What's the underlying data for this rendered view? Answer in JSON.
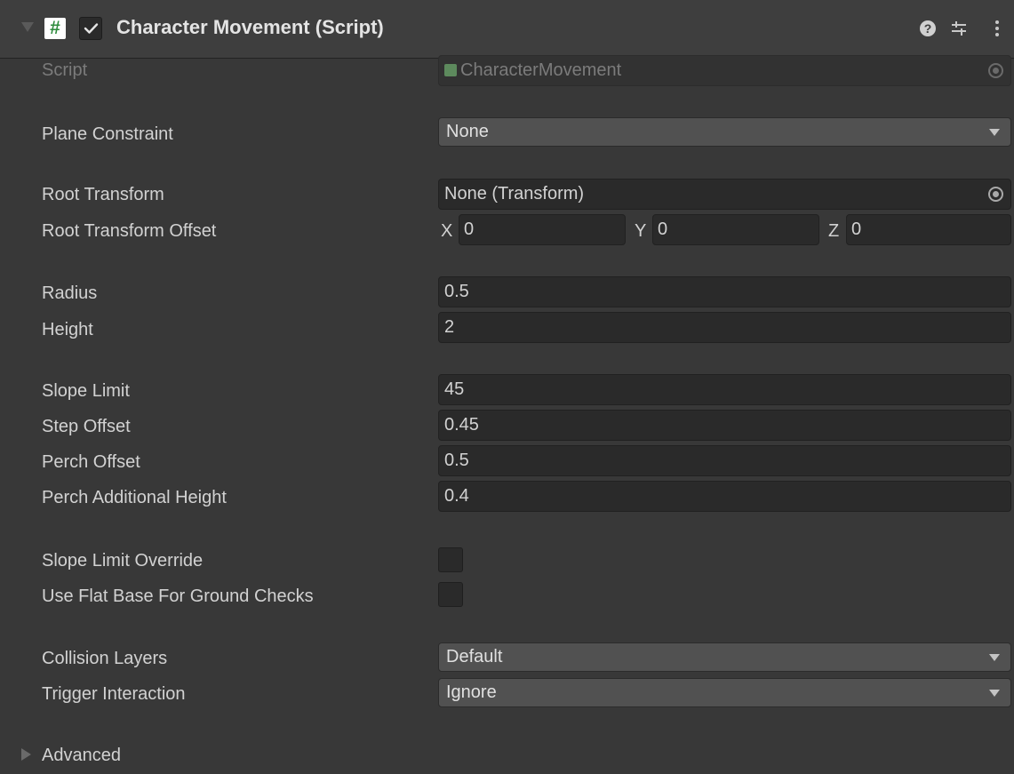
{
  "component": {
    "title": "Character Movement (Script)",
    "enabled": true,
    "script_icon_glyph": "#"
  },
  "fields": {
    "script": {
      "label": "Script",
      "value": "CharacterMovement"
    },
    "plane_constraint": {
      "label": "Plane Constraint",
      "value": "None"
    },
    "root_transform": {
      "label": "Root Transform",
      "value": "None (Transform)"
    },
    "root_transform_offset": {
      "label": "Root Transform Offset",
      "x_label": "X",
      "x": "0",
      "y_label": "Y",
      "y": "0",
      "z_label": "Z",
      "z": "0"
    },
    "radius": {
      "label": "Radius",
      "value": "0.5"
    },
    "height": {
      "label": "Height",
      "value": "2"
    },
    "slope_limit": {
      "label": "Slope Limit",
      "value": "45"
    },
    "step_offset": {
      "label": "Step Offset",
      "value": "0.45"
    },
    "perch_offset": {
      "label": "Perch Offset",
      "value": "0.5"
    },
    "perch_additional_height": {
      "label": "Perch Additional Height",
      "value": "0.4"
    },
    "slope_limit_override": {
      "label": "Slope Limit Override",
      "checked": false
    },
    "use_flat_base": {
      "label": "Use Flat Base For Ground Checks",
      "checked": false
    },
    "collision_layers": {
      "label": "Collision Layers",
      "value": "Default"
    },
    "trigger_interaction": {
      "label": "Trigger Interaction",
      "value": "Ignore"
    }
  },
  "advanced": {
    "label": "Advanced",
    "expanded": false
  },
  "icons": {
    "foldout": "triangle-down-icon",
    "help": "help-icon",
    "presets": "presets-icon",
    "menu": "kebab-menu-icon",
    "object_picker": "object-picker-icon"
  },
  "colors": {
    "background": "#383838",
    "header": "#3e3e3e",
    "field": "#2a2a2a",
    "dropdown": "#515151",
    "script_icon_fg": "#2e8b3d"
  }
}
